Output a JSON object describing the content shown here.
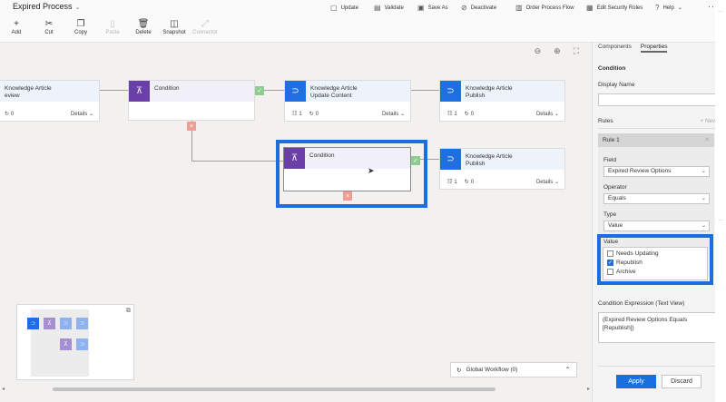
{
  "header": {
    "title": "Expired Process",
    "commands": [
      {
        "label": "Update",
        "icon": "save-icon"
      },
      {
        "label": "Validate",
        "icon": "validate-icon"
      },
      {
        "label": "Save As",
        "icon": "save-as-icon"
      },
      {
        "label": "Deactivate",
        "icon": "deactivate-icon"
      },
      {
        "label": "Order Process Flow",
        "icon": "order-icon"
      },
      {
        "label": "Edit Security Roles",
        "icon": "security-icon"
      },
      {
        "label": "Help",
        "icon": "help-icon"
      }
    ]
  },
  "toolbar": {
    "add": "Add",
    "cut": "Cut",
    "copy": "Copy",
    "paste": "Paste",
    "delete": "Delete",
    "snapshot": "Snapshot",
    "connector": "Connector"
  },
  "canvas": {
    "nodes": {
      "review": {
        "title1": "Knowledge Article",
        "title2": "eview",
        "count": "0",
        "details": "Details"
      },
      "condition1": {
        "title": "Condition"
      },
      "update_content": {
        "title1": "Knowledge Article",
        "title2": "Update Content",
        "steps": "1",
        "count": "0",
        "details": "Details"
      },
      "publish1": {
        "title1": "Knowledge Article",
        "title2": "Publish",
        "steps": "1",
        "count": "0",
        "details": "Details"
      },
      "condition2": {
        "title": "Condition"
      },
      "publish2": {
        "title1": "Knowledge Article",
        "title2": "Publish",
        "steps": "1",
        "count": "0",
        "details": "Details"
      }
    },
    "global_workflow": "Global Workflow (0)"
  },
  "panel": {
    "tabs": [
      "Components",
      "Properties"
    ],
    "section_title": "Condition",
    "display_name_label": "Display Name",
    "display_name_value": "",
    "rules_label": "Rules",
    "new_label": "+ New",
    "rule_title": "Rule 1",
    "field_label": "Field",
    "field_value": "Expired Review Options",
    "operator_label": "Operator",
    "operator_value": "Equals",
    "type_label": "Type",
    "type_value": "Value",
    "value_label": "Value",
    "value_options": [
      {
        "label": "Needs Updating",
        "checked": false
      },
      {
        "label": "Republish",
        "checked": true
      },
      {
        "label": "Archive",
        "checked": false
      }
    ],
    "expression_label": "Condition Expression (Text View)",
    "expression_text": "(Expired Review Options Equals [Republish])",
    "apply": "Apply",
    "discard": "Discard"
  }
}
